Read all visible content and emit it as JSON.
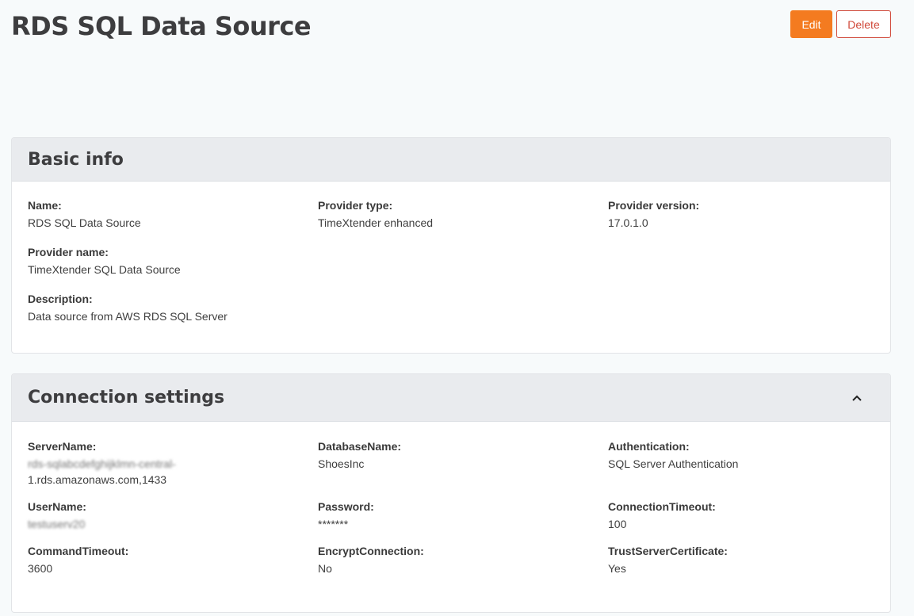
{
  "header": {
    "title": "RDS SQL Data Source",
    "edit_label": "Edit",
    "delete_label": "Delete"
  },
  "basic_info": {
    "title": "Basic info",
    "fields": {
      "name": {
        "label": "Name:",
        "value": "RDS SQL Data Source"
      },
      "provider_type": {
        "label": "Provider type:",
        "value": "TimeXtender enhanced"
      },
      "provider_version": {
        "label": "Provider version:",
        "value": "17.0.1.0"
      },
      "provider_name": {
        "label": "Provider name:",
        "value": "TimeXtender SQL Data Source"
      },
      "description": {
        "label": "Description:",
        "value": "Data source from AWS RDS SQL Server"
      }
    }
  },
  "connection_settings": {
    "title": "Connection settings",
    "collapse_icon": "chevron-up-icon",
    "fields": {
      "server_name": {
        "label": "ServerName:",
        "value_line1": "rds-sqlabcdefghijklmn-central-",
        "value_line2": "1.rds.amazonaws.com,1433"
      },
      "database_name": {
        "label": "DatabaseName:",
        "value": "ShoesInc"
      },
      "authentication": {
        "label": "Authentication:",
        "value": "SQL Server Authentication"
      },
      "user_name": {
        "label": "UserName:",
        "value": "testuserv20"
      },
      "password": {
        "label": "Password:",
        "value": "*******"
      },
      "connection_timeout": {
        "label": "ConnectionTimeout:",
        "value": "100"
      },
      "command_timeout": {
        "label": "CommandTimeout:",
        "value": "3600"
      },
      "encrypt_connection": {
        "label": "EncryptConnection:",
        "value": "No"
      },
      "trust_server_certificate": {
        "label": "TrustServerCertificate:",
        "value": "Yes"
      }
    }
  },
  "colors": {
    "accent": "#f47b20",
    "danger": "#d0493a"
  }
}
